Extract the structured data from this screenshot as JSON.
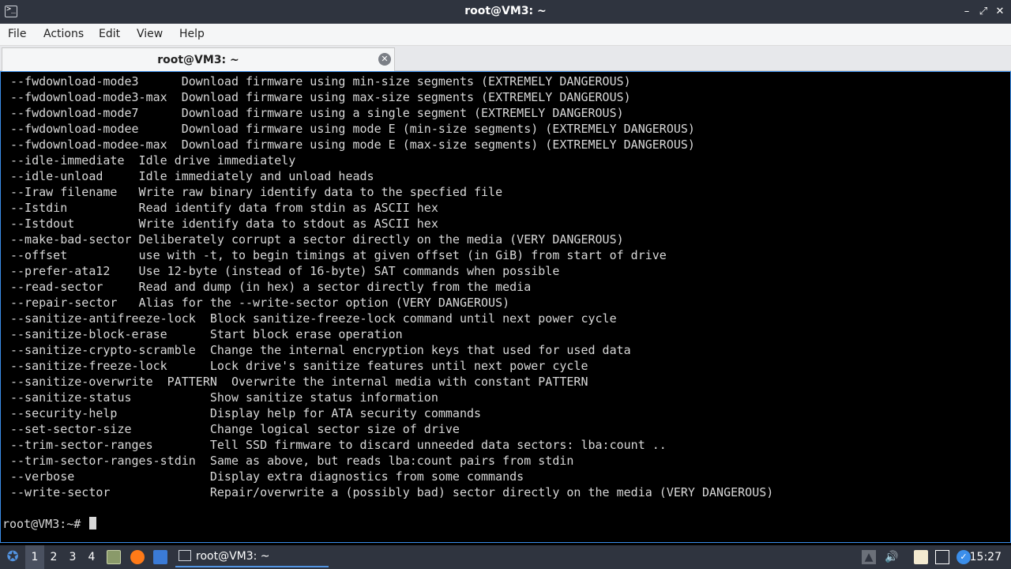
{
  "window": {
    "title": "root@VM3: ~",
    "buttons": {
      "minimize": "–",
      "maximize": "⤢",
      "close": "✕"
    }
  },
  "menu": [
    "File",
    "Actions",
    "Edit",
    "View",
    "Help"
  ],
  "tab": {
    "label": "root@VM3: ~",
    "close": "✕"
  },
  "terminal": {
    "lines": [
      "--fwdownload-mode3      Download firmware using min-size segments (EXTREMELY DANGEROUS)",
      "--fwdownload-mode3-max  Download firmware using max-size segments (EXTREMELY DANGEROUS)",
      "--fwdownload-mode7      Download firmware using a single segment (EXTREMELY DANGEROUS)",
      "--fwdownload-modee      Download firmware using mode E (min-size segments) (EXTREMELY DANGEROUS)",
      "--fwdownload-modee-max  Download firmware using mode E (max-size segments) (EXTREMELY DANGEROUS)",
      "--idle-immediate  Idle drive immediately",
      "--idle-unload     Idle immediately and unload heads",
      "--Iraw filename   Write raw binary identify data to the specfied file",
      "--Istdin          Read identify data from stdin as ASCII hex",
      "--Istdout         Write identify data to stdout as ASCII hex",
      "--make-bad-sector Deliberately corrupt a sector directly on the media (VERY DANGEROUS)",
      "--offset          use with -t, to begin timings at given offset (in GiB) from start of drive",
      "--prefer-ata12    Use 12-byte (instead of 16-byte) SAT commands when possible",
      "--read-sector     Read and dump (in hex) a sector directly from the media",
      "--repair-sector   Alias for the --write-sector option (VERY DANGEROUS)",
      "--sanitize-antifreeze-lock  Block sanitize-freeze-lock command until next power cycle",
      "--sanitize-block-erase      Start block erase operation",
      "--sanitize-crypto-scramble  Change the internal encryption keys that used for used data",
      "--sanitize-freeze-lock      Lock drive's sanitize features until next power cycle",
      "--sanitize-overwrite  PATTERN  Overwrite the internal media with constant PATTERN",
      "--sanitize-status           Show sanitize status information",
      "--security-help             Display help for ATA security commands",
      "--set-sector-size           Change logical sector size of drive",
      "--trim-sector-ranges        Tell SSD firmware to discard unneeded data sectors: lba:count ..",
      "--trim-sector-ranges-stdin  Same as above, but reads lba:count pairs from stdin",
      "--verbose                   Display extra diagnostics from some commands",
      "--write-sector              Repair/overwrite a (possibly bad) sector directly on the media (VERY DANGEROUS)"
    ],
    "prompt": "root@VM3:~# "
  },
  "taskbar": {
    "workspaces": [
      "1",
      "2",
      "3",
      "4"
    ],
    "active_workspace": "1",
    "task_label": "root@VM3: ~",
    "clock": "15:27"
  }
}
